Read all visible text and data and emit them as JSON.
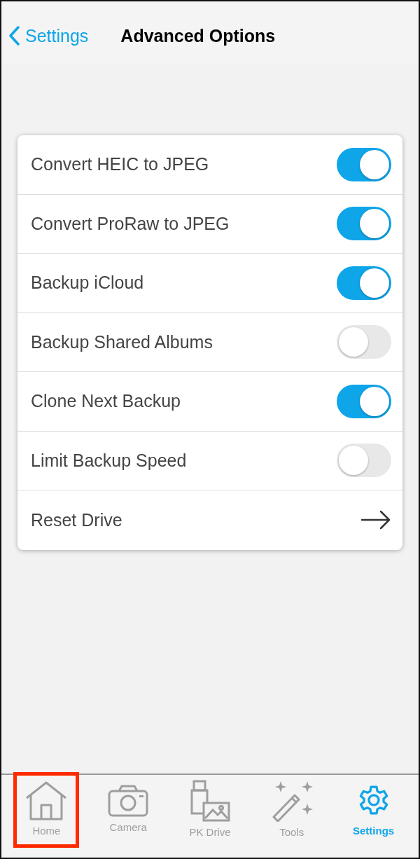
{
  "nav_bar": {
    "back_label": "Settings",
    "title": "Advanced Options"
  },
  "options": [
    {
      "kind": "toggle",
      "label": "Convert HEIC to JPEG",
      "on": true
    },
    {
      "kind": "toggle",
      "label": "Convert ProRaw to JPEG",
      "on": true
    },
    {
      "kind": "toggle",
      "label": "Backup iCloud",
      "on": true
    },
    {
      "kind": "toggle",
      "label": "Backup Shared Albums",
      "on": false
    },
    {
      "kind": "toggle",
      "label": "Clone Next Backup",
      "on": true
    },
    {
      "kind": "toggle",
      "label": "Limit Backup Speed",
      "on": false
    },
    {
      "kind": "link",
      "label": "Reset Drive"
    }
  ],
  "tab_bar": [
    {
      "label": "Home",
      "selected": false,
      "highlighted": true
    },
    {
      "label": "Camera",
      "selected": false,
      "highlighted": false
    },
    {
      "label": "PK Drive",
      "selected": false,
      "highlighted": false
    },
    {
      "label": "Tools",
      "selected": false,
      "highlighted": false
    },
    {
      "label": "Settings",
      "selected": true,
      "highlighted": false
    }
  ]
}
